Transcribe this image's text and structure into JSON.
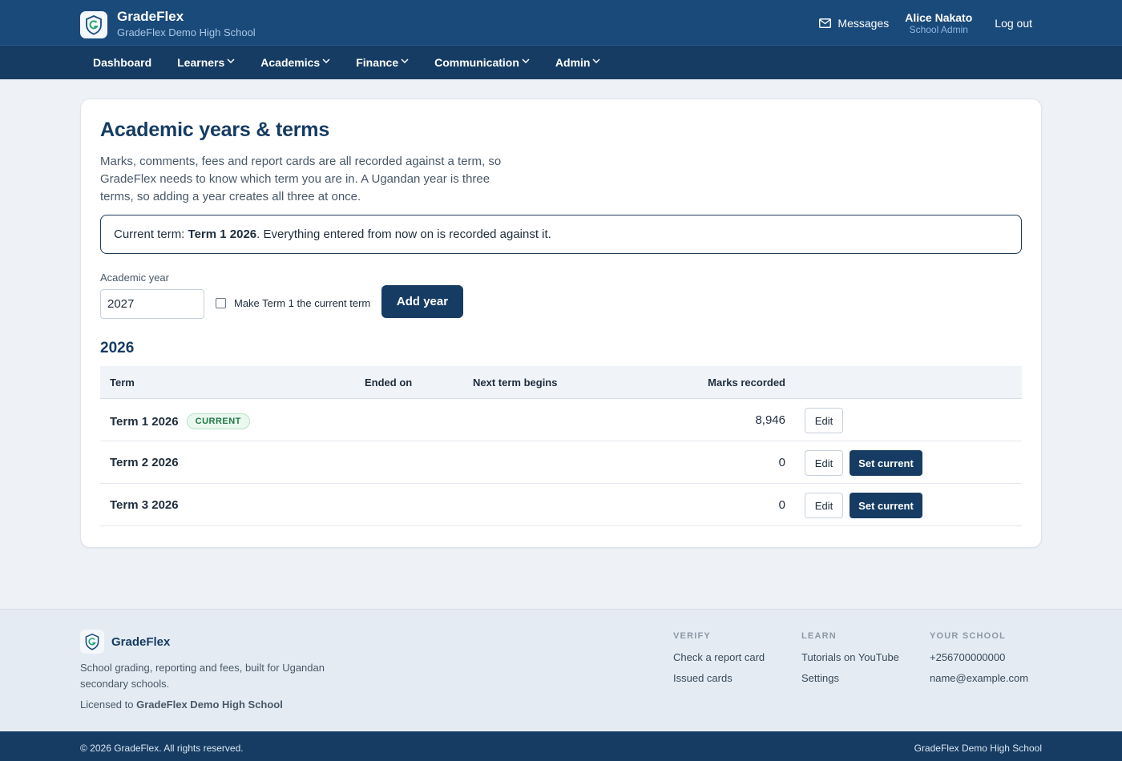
{
  "header": {
    "app_name": "GradeFlex",
    "school_name": "GradeFlex Demo High School",
    "messages_label": "Messages",
    "user_name": "Alice Nakato",
    "user_role": "School Admin",
    "logout_label": "Log out"
  },
  "nav": {
    "items": [
      "Dashboard",
      "Learners",
      "Academics",
      "Finance",
      "Communication",
      "Admin"
    ]
  },
  "page": {
    "title": "Academic years & terms",
    "intro": "Marks, comments, fees and report cards are all recorded against a term, so GradeFlex needs to know which term you are in. A Ugandan year is three terms, so adding a year creates all three at once.",
    "current_prefix": "Current term: ",
    "current_term": "Term 1 2026",
    "current_suffix": ". Everything entered from now on is recorded against it.",
    "year_field_label": "Academic year",
    "year_field_value": "2027",
    "make_current_label": "Make Term 1 the current term",
    "add_year_label": "Add year"
  },
  "year_section": {
    "year": "2026",
    "columns": {
      "term": "Term",
      "ended_on": "Ended on",
      "next_begins": "Next term begins",
      "marks": "Marks recorded"
    },
    "current_badge": "CURRENT",
    "edit_label": "Edit",
    "set_current_label": "Set current",
    "rows": [
      {
        "term": "Term 1 2026",
        "ended_on": "",
        "next_begins": "",
        "marks": "8,946"
      },
      {
        "term": "Term 2 2026",
        "ended_on": "",
        "next_begins": "",
        "marks": "0"
      },
      {
        "term": "Term 3 2026",
        "ended_on": "",
        "next_begins": "",
        "marks": "0"
      }
    ]
  },
  "footer": {
    "brand": "GradeFlex",
    "tagline": "School grading, reporting and fees, built for Ugandan secondary schools.",
    "licensed_prefix": "Licensed to ",
    "licensed_to": "GradeFlex Demo High School",
    "columns": [
      {
        "title": "VERIFY",
        "links": [
          "Check a report card",
          "Issued cards"
        ]
      },
      {
        "title": "LEARN",
        "links": [
          "Tutorials on YouTube",
          "Settings"
        ]
      },
      {
        "title": "YOUR SCHOOL",
        "links": [
          "+256700000000",
          "name@example.com"
        ]
      }
    ],
    "copyright": "© 2026 GradeFlex. All rights reserved.",
    "bottom_school": "GradeFlex Demo High School"
  },
  "colors": {
    "header_bg": "#1a4a7a",
    "nav_bg": "#163c63",
    "primary_button": "#163c63",
    "badge_green": "#1f7a45",
    "page_bg": "#eef2f6"
  },
  "icons": {
    "brand": "shield-g-logo-icon",
    "messages": "envelope-icon",
    "nav_dropdown": "chevron-down-icon"
  }
}
